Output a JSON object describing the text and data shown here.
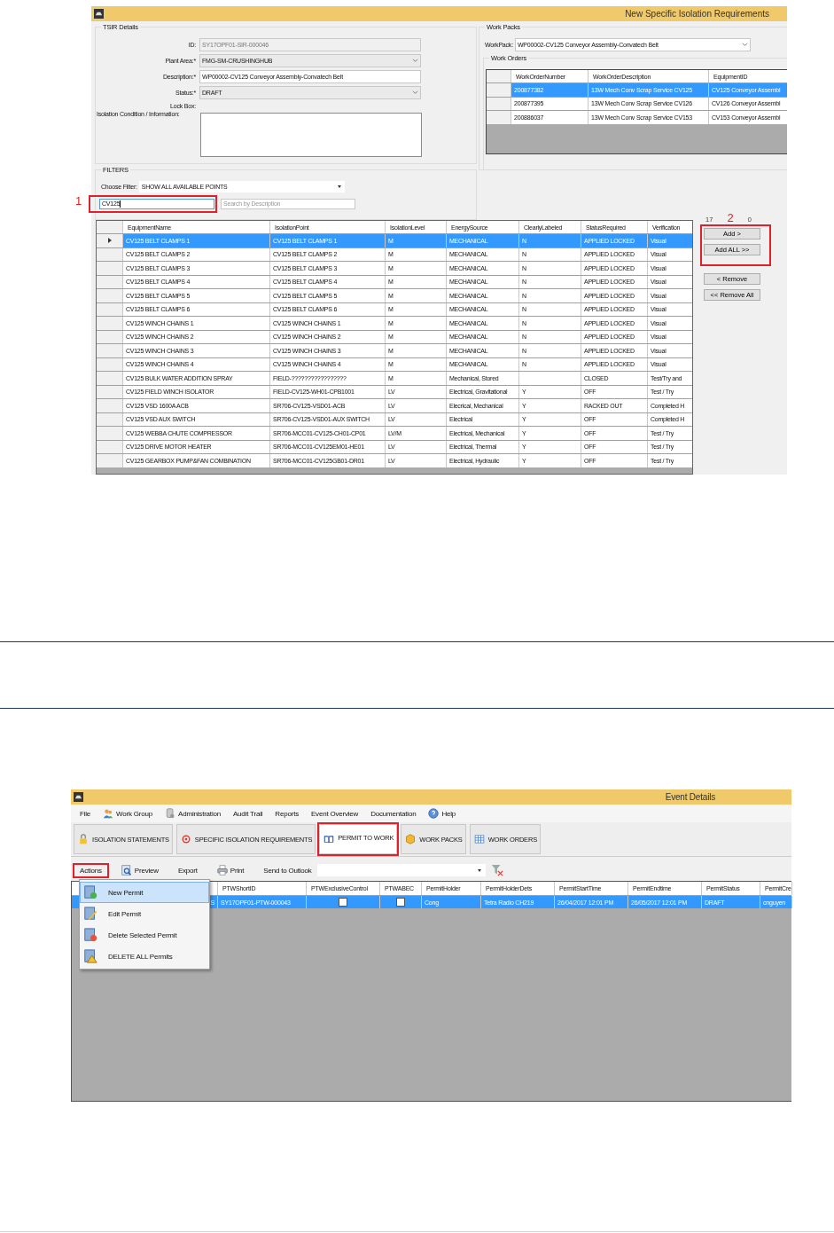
{
  "tsir_window": {
    "title": "New Specific Isolation Requirements",
    "tsir_details": {
      "legend": "TSIR Details",
      "fields": [
        {
          "kind": "readonly",
          "label": "ID:",
          "value": "SY17OPF01-SIR-000046"
        },
        {
          "kind": "combo",
          "label": "Plant Area:*",
          "value": "FMG-SM-CRUSHINGHUB"
        },
        {
          "kind": "text",
          "label": "Description:*",
          "value": "WP00002-CV125 Conveyor Assembly-Convatech Belt"
        },
        {
          "kind": "combo",
          "label": "Status:*",
          "value": "DRAFT"
        },
        {
          "kind": "label",
          "label": "Lock Box:"
        },
        {
          "kind": "textarea",
          "label": "Isolation Condition / Information:"
        }
      ]
    },
    "filters": {
      "legend": "FILTERS",
      "filter_label": "Choose Filter:",
      "filter_value": "SHOW ALL AVAILABLE POINTS",
      "search_value": "CV125",
      "search_highlighted": true,
      "description_placeholder": "Search by Description"
    },
    "work_packs": {
      "legend": "Work Packs",
      "workpack_label": "WorkPack:",
      "workpack_value": "WP00002-CV125 Conveyor Assembly-Convatech Belt",
      "work_orders_legend": "Work Orders",
      "columns": [
        "WorkOrderNumber",
        "WorkOrderDescription",
        "EquipmentID"
      ],
      "rows": [
        {
          "selected": true,
          "cells": [
            "200877382",
            "13W Mech Conv Scrap Service CV125",
            "CV125 Conveyor Assembl"
          ]
        },
        {
          "selected": false,
          "cells": [
            "200877395",
            "13W Mech Conv Scrap Service CV126",
            "CV126 Conveyor Assembl"
          ]
        },
        {
          "selected": false,
          "cells": [
            "200886037",
            "13W Mech Conv Scrap Service CV153",
            "CV153 Conveyor Assembl"
          ]
        }
      ]
    },
    "points": {
      "columns": [
        "EquipmentName",
        "IsolationPoint",
        "IsolationLevel",
        "EnergySource",
        "ClearlyLabeled",
        "StatusRequired",
        "Verification"
      ],
      "rows": [
        {
          "selected": true,
          "cells": [
            "CV125 BELT CLAMPS 1",
            "CV125 BELT CLAMPS 1",
            "M",
            "MECHANICAL",
            "N",
            "APPLIED LOCKED",
            "Visual"
          ]
        },
        {
          "selected": false,
          "cells": [
            "CV125 BELT CLAMPS 2",
            "CV125 BELT CLAMPS 2",
            "M",
            "MECHANICAL",
            "N",
            "APPLIED LOCKED",
            "Visual"
          ]
        },
        {
          "selected": false,
          "cells": [
            "CV125 BELT CLAMPS 3",
            "CV125 BELT CLAMPS 3",
            "M",
            "MECHANICAL",
            "N",
            "APPLIED LOCKED",
            "Visual"
          ]
        },
        {
          "selected": false,
          "cells": [
            "CV125 BELT CLAMPS 4",
            "CV125 BELT CLAMPS 4",
            "M",
            "MECHANICAL",
            "N",
            "APPLIED LOCKED",
            "Visual"
          ]
        },
        {
          "selected": false,
          "cells": [
            "CV125 BELT CLAMPS 5",
            "CV125 BELT CLAMPS 5",
            "M",
            "MECHANICAL",
            "N",
            "APPLIED LOCKED",
            "Visual"
          ]
        },
        {
          "selected": false,
          "cells": [
            "CV125 BELT CLAMPS 6",
            "CV125 BELT CLAMPS 6",
            "M",
            "MECHANICAL",
            "N",
            "APPLIED LOCKED",
            "Visual"
          ]
        },
        {
          "selected": false,
          "cells": [
            "CV125 WINCH CHAINS 1",
            "CV125 WINCH CHAINS 1",
            "M",
            "MECHANICAL",
            "N",
            "APPLIED LOCKED",
            "Visual"
          ]
        },
        {
          "selected": false,
          "cells": [
            "CV125 WINCH CHAINS 2",
            "CV125 WINCH CHAINS 2",
            "M",
            "MECHANICAL",
            "N",
            "APPLIED LOCKED",
            "Visual"
          ]
        },
        {
          "selected": false,
          "cells": [
            "CV125 WINCH CHAINS 3",
            "CV125 WINCH CHAINS 3",
            "M",
            "MECHANICAL",
            "N",
            "APPLIED LOCKED",
            "Visual"
          ]
        },
        {
          "selected": false,
          "cells": [
            "CV125 WINCH CHAINS 4",
            "CV125 WINCH CHAINS 4",
            "M",
            "MECHANICAL",
            "N",
            "APPLIED LOCKED",
            "Visual"
          ]
        },
        {
          "selected": false,
          "cells": [
            "CV125 BULK WATER ADDITION SPRAY",
            "FIELD-?????????????????",
            "M",
            "Mechanical, Stored",
            "",
            "CLOSED",
            "Test/Try and"
          ]
        },
        {
          "selected": false,
          "cells": [
            "CV125 FIELD WINCH ISOLATOR",
            "FIELD-CV125-WH01-CPB1001",
            "LV",
            "Electrical, Gravitational",
            "Y",
            "OFF",
            "Test / Try"
          ]
        },
        {
          "selected": false,
          "cells": [
            "CV125 VSD 1600A ACB",
            "SR706-CV125-VSD01-ACB",
            "LV",
            "Elecrical, Mechanical",
            "Y",
            "RACKED OUT",
            "Completed H"
          ]
        },
        {
          "selected": false,
          "cells": [
            "CV125 VSD AUX SWITCH",
            "SR706-CV125-VSD01-AUX SWITCH",
            "LV",
            "Electrical",
            "Y",
            "OFF",
            "Completed H"
          ]
        },
        {
          "selected": false,
          "cells": [
            "CV125 WEBBA CHUTE COMPRESSOR",
            "SR706-MCC01-CV125-CH01-CP01",
            "LV/M",
            "Electrical, Mechanical",
            "Y",
            "OFF",
            "Test / Try"
          ]
        },
        {
          "selected": false,
          "cells": [
            "CV125 DRIVE MOTOR HEATER",
            "SR706-MCC01-CV125EM01-HE01",
            "LV",
            "Electrical, Thermal",
            "Y",
            "OFF",
            "Test / Try"
          ]
        },
        {
          "selected": false,
          "cells": [
            "CV125 GEARBOX PUMP&FAN COMBINATION",
            "SR706-MCC01-CV125GB01-DR01",
            "LV",
            "Electrical, Hydraulic",
            "Y",
            "OFF",
            "Test / Try"
          ]
        }
      ]
    },
    "available_count": "17",
    "selected_count": "0",
    "button_groups": [
      {
        "highlighted": true,
        "buttons": [
          "Add >",
          "Add ALL >>"
        ]
      },
      {
        "highlighted": false,
        "buttons": [
          "< Remove",
          "<< Remove All"
        ]
      }
    ]
  },
  "annotations": [
    {
      "label": "1"
    },
    {
      "label": "2"
    }
  ],
  "event_window": {
    "title": "Event Details",
    "menu": [
      "File",
      "Work Group",
      "Administration",
      "Audit Trail",
      "Reports",
      "Event Overview",
      "Documentation",
      "Help"
    ],
    "tabs": [
      {
        "label": "ISOLATION STATEMENTS",
        "selected": false,
        "highlighted": false
      },
      {
        "label": "SPECIFIC ISOLATION REQUIREMENTS",
        "selected": false,
        "highlighted": false
      },
      {
        "label": "PERMIT TO WORK",
        "selected": true,
        "highlighted": true
      },
      {
        "label": "WORK PACKS",
        "selected": false,
        "highlighted": false
      },
      {
        "label": "WORK ORDERS",
        "selected": false,
        "highlighted": false
      }
    ],
    "toolbar": [
      {
        "label": "Actions",
        "highlighted": true
      },
      {
        "label": "Preview",
        "highlighted": false
      },
      {
        "label": "Export",
        "highlighted": false
      },
      {
        "label": "Print",
        "highlighted": false
      },
      {
        "label": "Send to Outlook",
        "highlighted": false
      }
    ],
    "columns": [
      "PTWShortID",
      "PTWExclusiveControl",
      "PTWABEC",
      "PermitHolder",
      "PermitHolderDets",
      "PermitStartTime",
      "PermitEndtime",
      "PermitStatus",
      "PermitCre"
    ],
    "rows": [
      {
        "selected": true,
        "lead": "S",
        "cells": [
          {
            "kind": "text",
            "text": "SY17OPF01-PTW-000043"
          },
          {
            "kind": "check",
            "checked": false
          },
          {
            "kind": "check",
            "checked": false
          },
          {
            "kind": "text",
            "text": "Cong"
          },
          {
            "kind": "text",
            "text": "Tetra Radio CH219"
          },
          {
            "kind": "text",
            "text": "26/04/2017 12:01 PM"
          },
          {
            "kind": "text",
            "text": "26/05/2017 12:01 PM"
          },
          {
            "kind": "text",
            "text": "DRAFT"
          },
          {
            "kind": "text",
            "text": "cnguyen"
          }
        ]
      }
    ],
    "actions_menu": [
      {
        "label": "New Permit",
        "selected": true
      },
      {
        "label": "Edit Permit",
        "selected": false
      },
      {
        "label": "Delete Selected Permit",
        "selected": false
      },
      {
        "label": "DELETE ALL Permits",
        "selected": false
      }
    ]
  }
}
